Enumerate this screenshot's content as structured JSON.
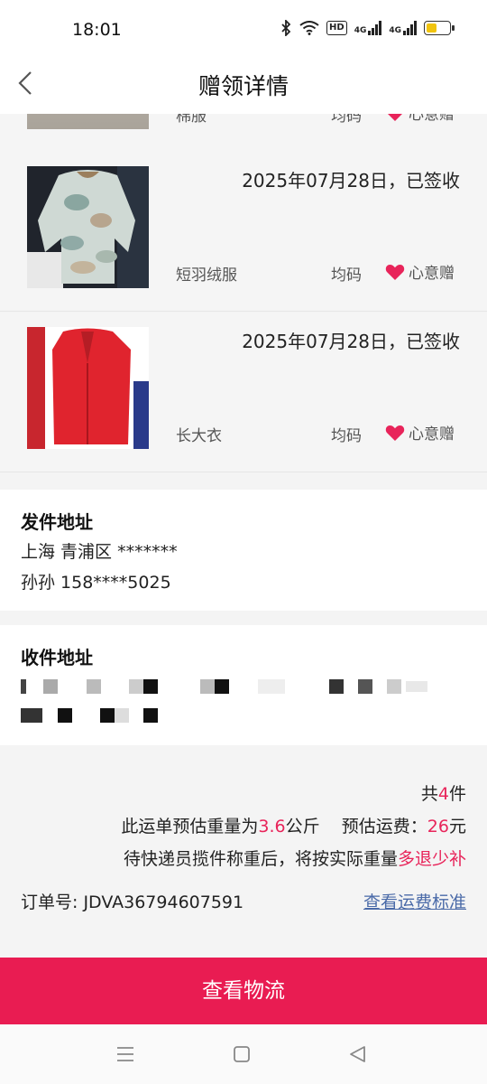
{
  "status_bar": {
    "time": "18:01",
    "hd_label": "HD",
    "net1": "4G",
    "net2": "4G",
    "battery_level": 0.45
  },
  "nav": {
    "title": "赠领详情"
  },
  "items": [
    {
      "name": "棉服",
      "size": "均码",
      "gift": "心意赠",
      "date": ""
    },
    {
      "name": "短羽绒服",
      "size": "均码",
      "gift": "心意赠",
      "date": "2025年07月28日，已签收"
    },
    {
      "name": "长大衣",
      "size": "均码",
      "gift": "心意赠",
      "date": "2025年07月28日，已签收"
    }
  ],
  "sender": {
    "title": "发件地址",
    "address": "上海 青浦区 *******",
    "contact": "孙孙 158****5025"
  },
  "receiver": {
    "title": "收件地址"
  },
  "summary": {
    "count_prefix": "共",
    "count": "4",
    "count_suffix": "件",
    "weight_prefix": "此运单预估重量为",
    "weight": "3.6",
    "weight_unit": "公斤",
    "fee_label": "预估运费：",
    "fee": "26",
    "fee_unit": "元",
    "notice_prefix": "待快递员揽件称重后，将按实际重量",
    "notice_highlight": "多退少补",
    "order_label": "订单号:",
    "order_no": "JDVA36794607591",
    "fee_link": "查看运费标准"
  },
  "actions": {
    "logistics": "查看物流"
  },
  "colors": {
    "accent": "#e91c52",
    "highlight": "#e8245a",
    "link": "#4a6aa8"
  },
  "icons": {
    "back": "chevron-left-icon",
    "gift": "heart-icon",
    "menu": "menu-icon",
    "home": "square-home-icon",
    "recent": "triangle-back-icon"
  }
}
